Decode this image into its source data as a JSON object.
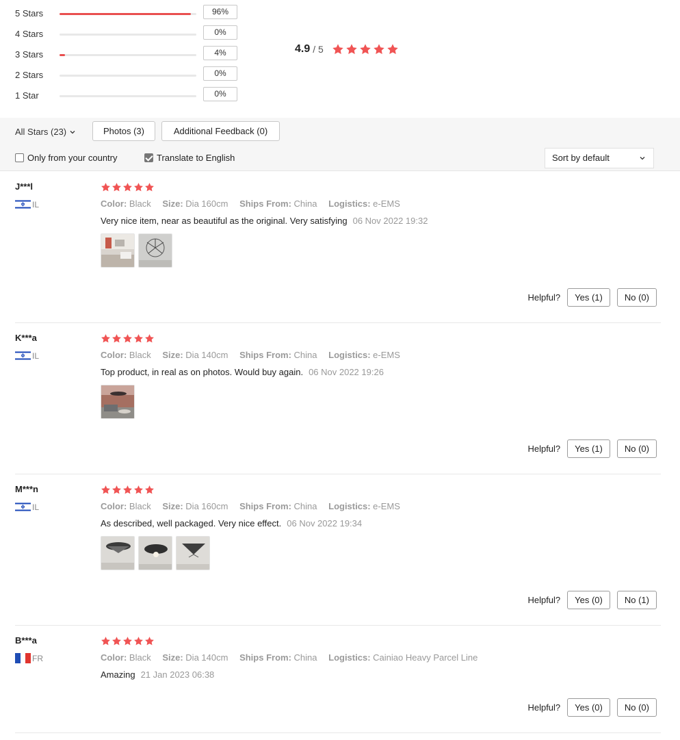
{
  "summary": {
    "histogram": [
      {
        "label": "5 Stars",
        "percent_text": "96%",
        "fraction": 0.96
      },
      {
        "label": "4 Stars",
        "percent_text": "0%",
        "fraction": 0
      },
      {
        "label": "3 Stars",
        "percent_text": "4%",
        "fraction": 0.04
      },
      {
        "label": "2 Stars",
        "percent_text": "0%",
        "fraction": 0
      },
      {
        "label": "1 Star",
        "percent_text": "0%",
        "fraction": 0
      }
    ],
    "score": "4.9",
    "out_of": "/ 5",
    "star_count": 5
  },
  "filters": {
    "all_stars": "All Stars (23)",
    "photos": "Photos (3)",
    "additional_feedback": "Additional Feedback (0)",
    "only_country_label": "Only from your country",
    "only_country_checked": false,
    "translate_label": "Translate to English",
    "translate_checked": true,
    "sort_value": "Sort by default"
  },
  "labels": {
    "color": "Color:",
    "size": "Size:",
    "ships_from": "Ships From:",
    "logistics": "Logistics:",
    "helpful": "Helpful?"
  },
  "reviews": [
    {
      "name": "J***l",
      "country": "IL",
      "flag": "israel-flag",
      "stars": 5,
      "color": "Black",
      "size": "Dia 160cm",
      "ships_from": "China",
      "logistics": "e-EMS",
      "text": "Very nice item, near as beautiful as the original. Very satisfying",
      "date": "06 Nov 2022 19:32",
      "photo_count": 2,
      "yes": "Yes (1)",
      "no": "No (0)"
    },
    {
      "name": "K***a",
      "country": "IL",
      "flag": "israel-flag",
      "stars": 5,
      "color": "Black",
      "size": "Dia 140cm",
      "ships_from": "China",
      "logistics": "e-EMS",
      "text": "Top product, in real as on photos. Would buy again.",
      "date": "06 Nov 2022 19:26",
      "photo_count": 1,
      "yes": "Yes (1)",
      "no": "No (0)"
    },
    {
      "name": "M***n",
      "country": "IL",
      "flag": "israel-flag",
      "stars": 5,
      "color": "Black",
      "size": "Dia 160cm",
      "ships_from": "China",
      "logistics": "e-EMS",
      "text": "As described, well packaged. Very nice effect.",
      "date": "06 Nov 2022 19:34",
      "photo_count": 3,
      "yes": "Yes (0)",
      "no": "No (1)"
    },
    {
      "name": "B***a",
      "country": "FR",
      "flag": "france-flag",
      "stars": 5,
      "color": "Black",
      "size": "Dia 140cm",
      "ships_from": "China",
      "logistics": "Cainiao Heavy Parcel Line",
      "text": "Amazing",
      "date": "21 Jan 2023 06:38",
      "photo_count": 0,
      "yes": "Yes (0)",
      "no": "No (0)"
    }
  ],
  "colors": {
    "accent_red": "#e94f4f",
    "star_red": "#f05454"
  }
}
